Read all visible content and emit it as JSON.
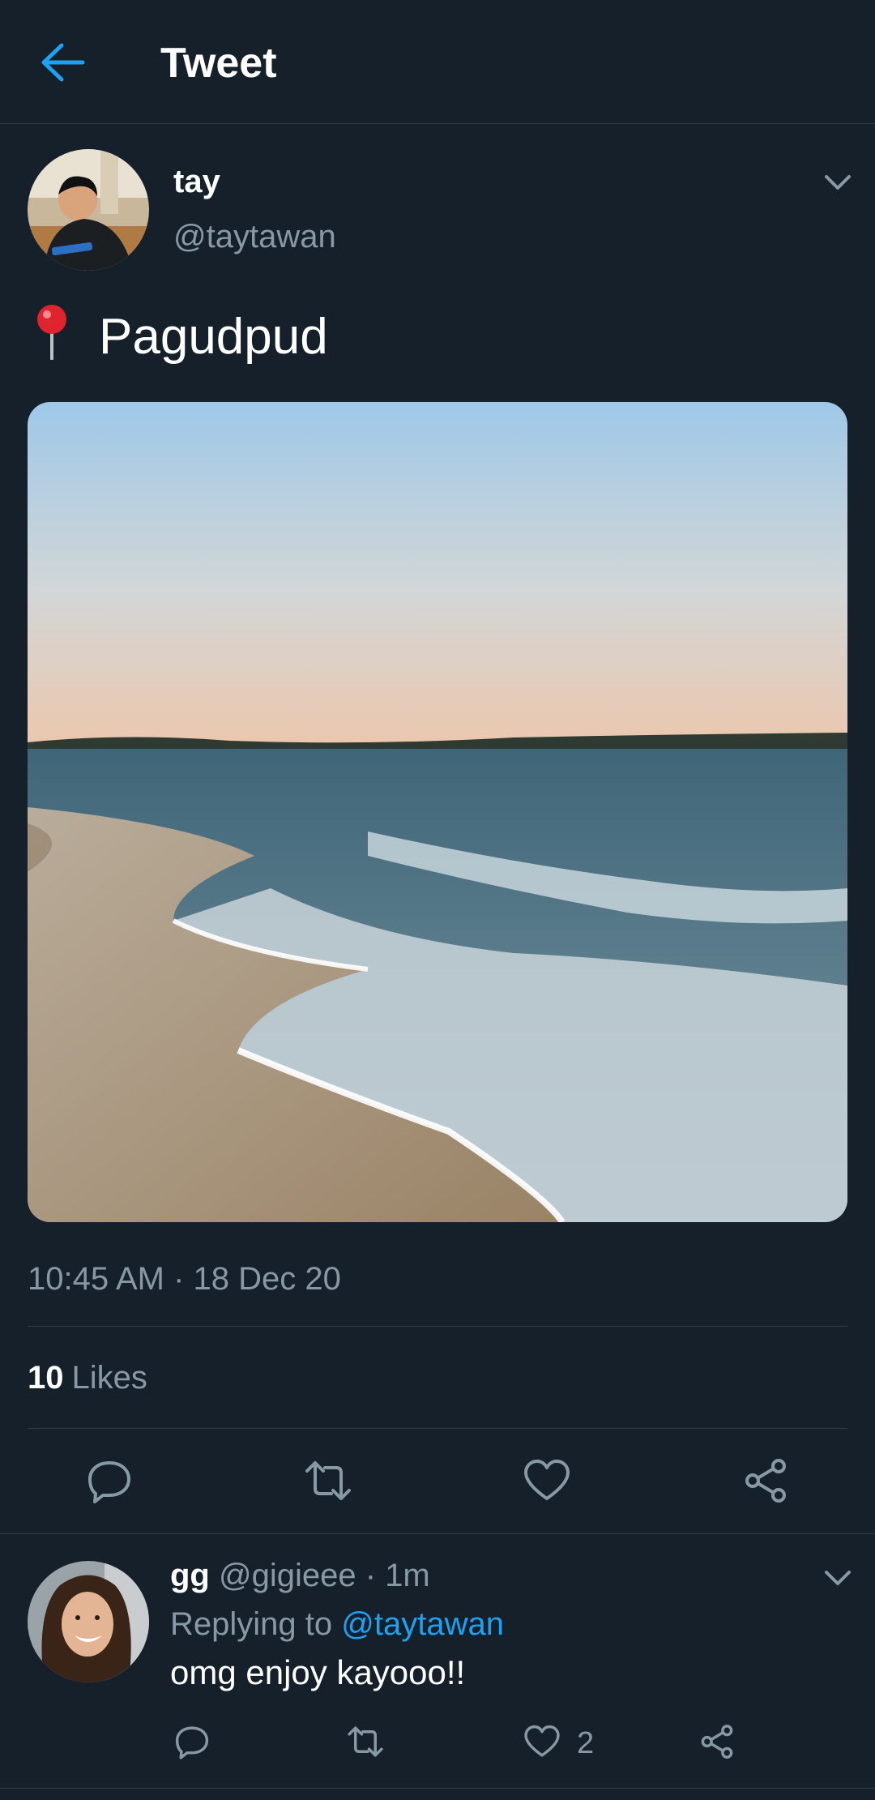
{
  "header": {
    "title": "Tweet"
  },
  "tweet": {
    "author_name": "tay",
    "author_handle": "@taytawan",
    "text": "Pagudpud",
    "timestamp": "10:45 AM · 18 Dec 20",
    "likes_count": "10",
    "likes_label": "Likes"
  },
  "reply": {
    "author_name": "gg",
    "author_handle": "@gigieee",
    "separator": "·",
    "time": "1m",
    "replying_prefix": "Replying to",
    "replying_to": "@taytawan",
    "text": "omg enjoy kayooo!!",
    "like_count": "2"
  },
  "colors": {
    "background": "#15202b",
    "accent": "#1da1f2",
    "muted": "#8899a6",
    "divider": "#2f3b47"
  },
  "icons": {
    "back": "arrow-left-icon",
    "menu": "chevron-down-icon",
    "pin": "round-pushpin-icon",
    "reply": "reply-icon",
    "retweet": "retweet-icon",
    "like": "heart-icon",
    "share": "share-icon"
  }
}
